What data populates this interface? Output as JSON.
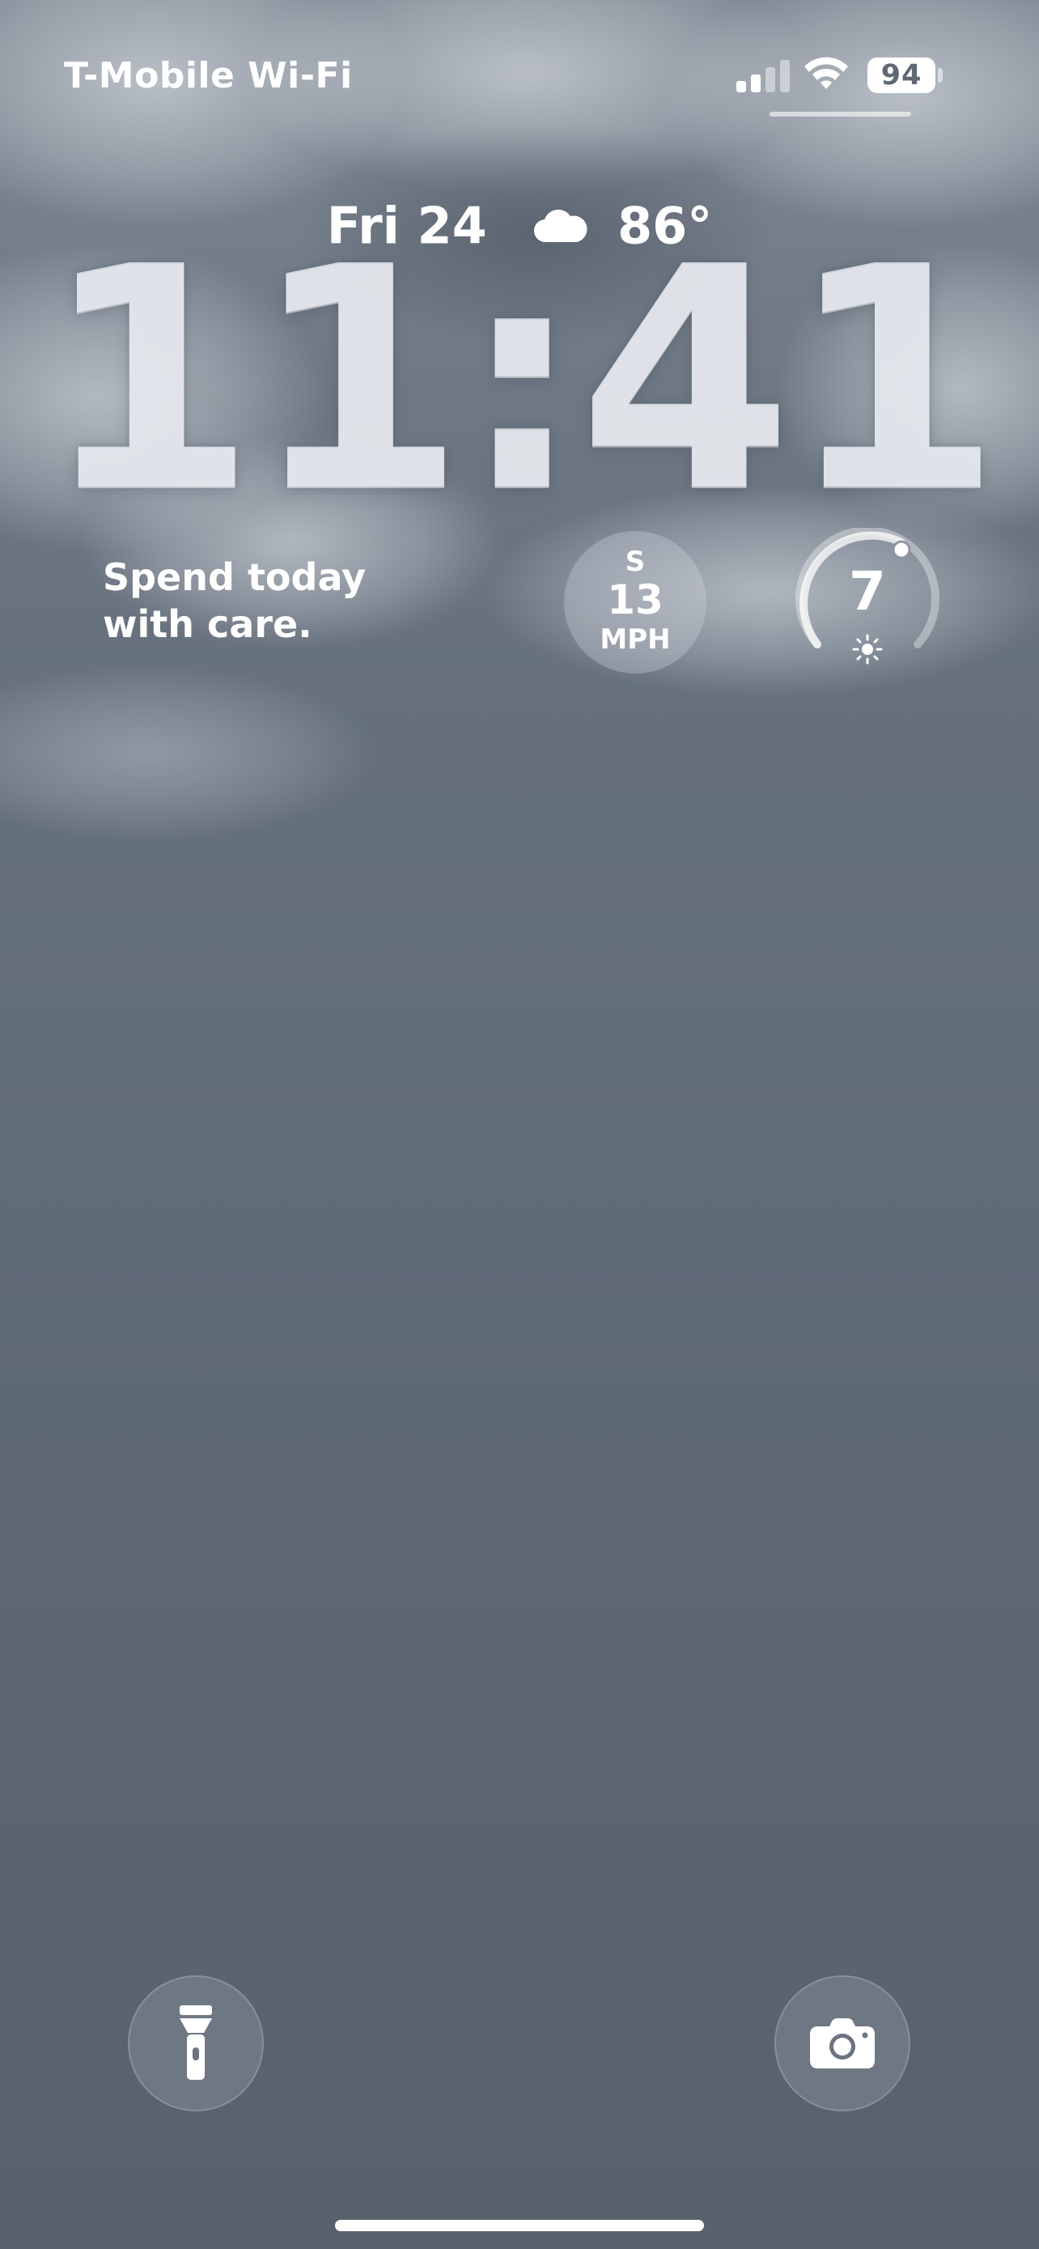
{
  "status_bar": {
    "carrier": "T-Mobile Wi-Fi",
    "signal_icon": "cellular-signal-icon",
    "wifi_icon": "wifi-icon",
    "battery_level": "94"
  },
  "lock_screen": {
    "date": "Fri 24",
    "weather_icon": "cloud-icon",
    "temperature": "86°",
    "time": "11:41"
  },
  "widgets": {
    "quote_line1": "Spend today",
    "quote_line2": "with care.",
    "wind": {
      "direction": "S",
      "speed": "13",
      "unit": "MPH"
    },
    "uv_index": {
      "value": "7",
      "icon": "sun-icon"
    }
  },
  "quick_actions": {
    "left_icon": "flashlight-icon",
    "right_icon": "camera-icon"
  },
  "colors": {
    "text": "#ffffff",
    "background_top": "#7f8893",
    "background_bottom": "#58626d"
  }
}
